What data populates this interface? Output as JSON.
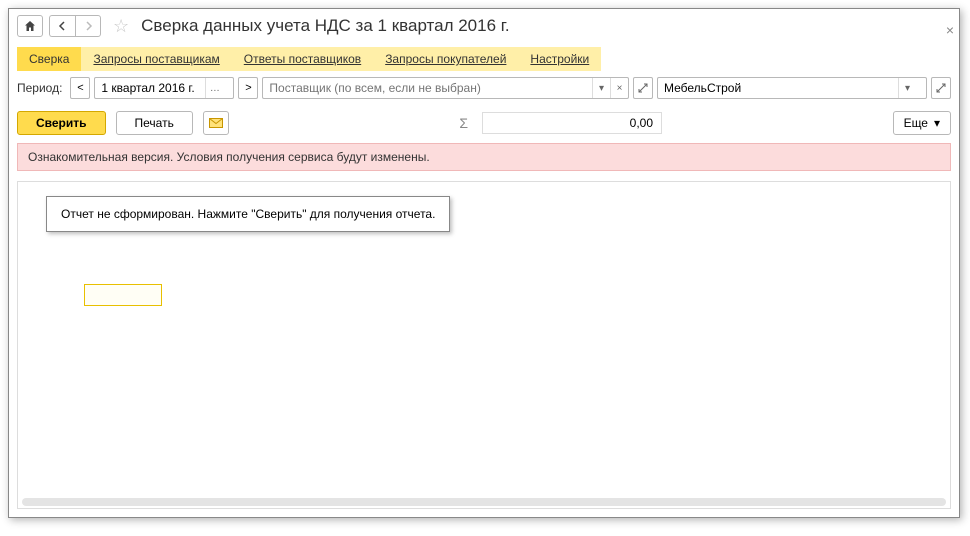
{
  "header": {
    "title": "Сверка данных учета НДС за 1 квартал 2016 г."
  },
  "tabs": [
    {
      "label": "Сверка",
      "active": true
    },
    {
      "label": "Запросы поставщикам",
      "active": false
    },
    {
      "label": "Ответы поставщиков",
      "active": false
    },
    {
      "label": "Запросы покупателей",
      "active": false
    },
    {
      "label": "Настройки",
      "active": false
    }
  ],
  "filter": {
    "period_label": "Период:",
    "period_value": "1 квартал 2016 г.",
    "supplier_placeholder": "Поставщик (по всем, если не выбран)",
    "org_value": "МебельСтрой"
  },
  "actions": {
    "verify_label": "Сверить",
    "print_label": "Печать",
    "sum_value": "0,00",
    "more_label": "Еще"
  },
  "warning": {
    "text": "Ознакомительная версия. Условия получения сервиса будут изменены."
  },
  "content": {
    "report_placeholder": "Отчет не сформирован. Нажмите \"Сверить\" для получения отчета."
  }
}
